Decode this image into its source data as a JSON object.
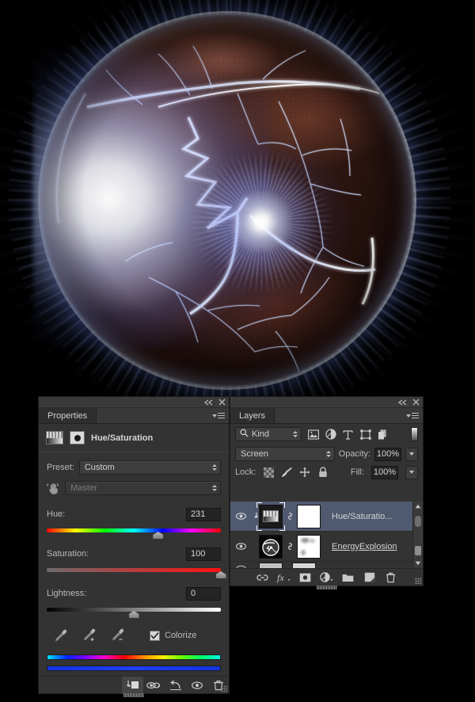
{
  "artwork": {
    "description": "Cracked glowing energy sphere with blue-white light bursts on black background"
  },
  "properties_panel": {
    "tab_label": "Properties",
    "title": "Hue/Saturation",
    "collapse_icon": "collapse-double-arrow-icon",
    "close_icon": "close-icon",
    "menu_icon": "panel-menu-icon",
    "adjustment_icon": "hue-saturation-adjustment-icon",
    "mask_icon": "layer-mask-icon",
    "preset": {
      "label": "Preset:",
      "value": "Custom"
    },
    "channel": {
      "value": "Master",
      "disabled": true,
      "hand_icon": "on-image-adjust-hand-icon"
    },
    "sliders": [
      {
        "label": "Hue:",
        "value": "231",
        "position_pct": 64,
        "track": "hue"
      },
      {
        "label": "Saturation:",
        "value": "100",
        "position_pct": 100,
        "track": "saturation"
      },
      {
        "label": "Lightness:",
        "value": "0",
        "position_pct": 50,
        "track": "lightness"
      }
    ],
    "eyedroppers": [
      "eyedropper-icon",
      "eyedropper-add-icon",
      "eyedropper-subtract-icon"
    ],
    "colorize": {
      "label": "Colorize",
      "checked": true
    },
    "color_bars": {
      "top": "hue-spectrum-bar",
      "bottom": "result-color-bar"
    },
    "footer_buttons": [
      {
        "name": "clip-to-layer-button",
        "icon": "clip-to-layer-icon",
        "selected": true
      },
      {
        "name": "toggle-previous-state-button",
        "icon": "previous-state-icon",
        "selected": false
      },
      {
        "name": "reset-button",
        "icon": "reset-arrow-icon",
        "selected": false
      },
      {
        "name": "toggle-visibility-button",
        "icon": "eye-icon",
        "selected": false
      },
      {
        "name": "delete-adjustment-button",
        "icon": "trash-icon",
        "selected": false
      }
    ]
  },
  "layers_panel": {
    "tab_label": "Layers",
    "collapse_icon": "collapse-double-arrow-icon",
    "close_icon": "close-icon",
    "menu_icon": "panel-menu-icon",
    "filter": {
      "kind_label": "Kind",
      "search_icon": "search-icon",
      "icons": [
        "pixel-filter-icon",
        "adjustment-filter-icon",
        "type-filter-icon",
        "shape-filter-icon",
        "smart-object-filter-icon"
      ],
      "toggle_name": "filter-enable-toggle"
    },
    "blend_mode": "Screen",
    "opacity": {
      "label": "Opacity:",
      "value": "100%"
    },
    "fill": {
      "label": "Fill:",
      "value": "100%"
    },
    "lock": {
      "label": "Lock:",
      "icons": [
        "lock-transparent-pixels-icon",
        "lock-image-pixels-icon",
        "lock-position-icon",
        "lock-all-icon"
      ]
    },
    "layers": [
      {
        "name": "Hue/Saturatio...",
        "visible": true,
        "selected": true,
        "clipped": true,
        "linked": true,
        "thumb_type": "adjustment",
        "mask": "white",
        "editing": false
      },
      {
        "name": "EnergyExplosion",
        "visible": true,
        "selected": false,
        "clipped": false,
        "linked": true,
        "thumb_type": "image",
        "mask": "white-with-blobs",
        "editing": true
      }
    ],
    "footer_buttons": [
      {
        "name": "link-layers-button",
        "icon": "link-icon"
      },
      {
        "name": "layer-style-button",
        "icon": "fx-icon"
      },
      {
        "name": "add-layer-mask-button",
        "icon": "mask-icon"
      },
      {
        "name": "new-adjustment-layer-button",
        "icon": "adjustment-circle-icon"
      },
      {
        "name": "new-group-button",
        "icon": "folder-icon"
      },
      {
        "name": "new-layer-button",
        "icon": "new-layer-icon"
      },
      {
        "name": "delete-layer-button",
        "icon": "trash-icon"
      }
    ],
    "scrollbar": {
      "up_icon": "scroll-up-arrow-icon",
      "down_icon": "scroll-down-arrow-icon"
    }
  },
  "colors": {
    "panel_bg": "#333333",
    "panel_header": "#383838",
    "selected_layer": "#4f5a70",
    "text": "#c8c8c8",
    "field_bg": "#242424"
  }
}
